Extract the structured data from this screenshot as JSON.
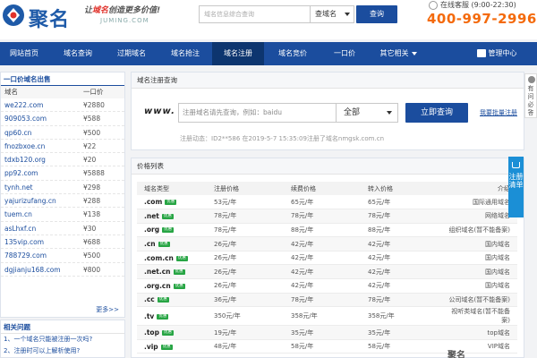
{
  "header": {
    "logo_text": "聚名",
    "slogan_pre": "让",
    "slogan_hl": "域名",
    "slogan_post": "创造更多价值!",
    "slogan_sub": "JUMING.COM",
    "search_placeholder": "域名信息综合查询",
    "search_select": "查域名",
    "search_button": "查询",
    "service_label": "在线客服",
    "service_hours": "(9:00-22:30)",
    "hotline": "400-997-2996"
  },
  "nav": {
    "items": [
      "网站首页",
      "域名查询",
      "过期域名",
      "域名抢注",
      "域名注册",
      "域名竞价",
      "一口价",
      "其它相关"
    ],
    "active": "域名注册",
    "management": "管理中心"
  },
  "left": {
    "title": "一口价域名出售",
    "col_domain": "域名",
    "col_price": "一口价",
    "rows": [
      {
        "domain": "we222.com",
        "price": "¥2880"
      },
      {
        "domain": "909053.com",
        "price": "¥588"
      },
      {
        "domain": "qp60.cn",
        "price": "¥500"
      },
      {
        "domain": "fnozbxoe.cn",
        "price": "¥22"
      },
      {
        "domain": "tdxb120.org",
        "price": "¥20"
      },
      {
        "domain": "pp92.com",
        "price": "¥5888"
      },
      {
        "domain": "tynh.net",
        "price": "¥298"
      },
      {
        "domain": "yajurizufang.cn",
        "price": "¥288"
      },
      {
        "domain": "tuem.cn",
        "price": "¥138"
      },
      {
        "domain": "asLhxf.cn",
        "price": "¥30"
      },
      {
        "domain": "135vip.com",
        "price": "¥688"
      },
      {
        "domain": "788729.com",
        "price": "¥500"
      },
      {
        "domain": "dgjianju168.com",
        "price": "¥800"
      }
    ],
    "more": "更多>>"
  },
  "faq": {
    "title": "相关问题",
    "items": [
      "1、一个域名只能被注册一次吗?",
      "2、注册时可以上解析使用?"
    ]
  },
  "register": {
    "title": "域名注册查询",
    "www": "www.",
    "input_placeholder": "注册域名请先查询，例如：baidu",
    "select_value": "全部",
    "button": "立即查询",
    "bulk_link": "我要批量注册",
    "news": "注册动态：ID2**586 在2019-5-7 15:35:09注册了域名nmgsk.com.cn"
  },
  "prices": {
    "title": "价格列表",
    "headers": [
      "域名类型",
      "注册价格",
      "续费价格",
      "转入价格",
      "介绍"
    ],
    "tag_label": "优惠",
    "rows": [
      {
        "tld": ".com",
        "reg": "53元/年",
        "renew": "65元/年",
        "transfer": "65元/年",
        "desc": "国际通用域名"
      },
      {
        "tld": ".net",
        "reg": "78元/年",
        "renew": "78元/年",
        "transfer": "78元/年",
        "desc": "网络域名"
      },
      {
        "tld": ".org",
        "reg": "78元/年",
        "renew": "88元/年",
        "transfer": "88元/年",
        "desc": "组织域名(暂不能备案)"
      },
      {
        "tld": ".cn",
        "reg": "26元/年",
        "renew": "42元/年",
        "transfer": "42元/年",
        "desc": "国内域名"
      },
      {
        "tld": ".com.cn",
        "reg": "26元/年",
        "renew": "42元/年",
        "transfer": "42元/年",
        "desc": "国内域名"
      },
      {
        "tld": ".net.cn",
        "reg": "26元/年",
        "renew": "42元/年",
        "transfer": "42元/年",
        "desc": "国内域名"
      },
      {
        "tld": ".org.cn",
        "reg": "26元/年",
        "renew": "42元/年",
        "transfer": "42元/年",
        "desc": "国内域名"
      },
      {
        "tld": ".cc",
        "reg": "36元/年",
        "renew": "78元/年",
        "transfer": "78元/年",
        "desc": "公司域名(暂不能备案)"
      },
      {
        "tld": ".tv",
        "reg": "350元/年",
        "renew": "358元/年",
        "transfer": "358元/年",
        "desc": "视听类域名(暂不能备案)"
      },
      {
        "tld": ".top",
        "reg": "19元/年",
        "renew": "35元/年",
        "transfer": "35元/年",
        "desc": "top域名"
      },
      {
        "tld": ".vip",
        "reg": "48元/年",
        "renew": "58元/年",
        "transfer": "58元/年",
        "desc": "VIP域名"
      }
    ]
  },
  "side": {
    "cart_label": "注册清单",
    "ask_label": "有问必答"
  },
  "colors": {
    "brand_blue": "#1b4d9e",
    "hotline_orange": "#f46a0c",
    "price_red": "#e0312a",
    "tag_green": "#27a544",
    "side_blue": "#1b8fd6"
  }
}
